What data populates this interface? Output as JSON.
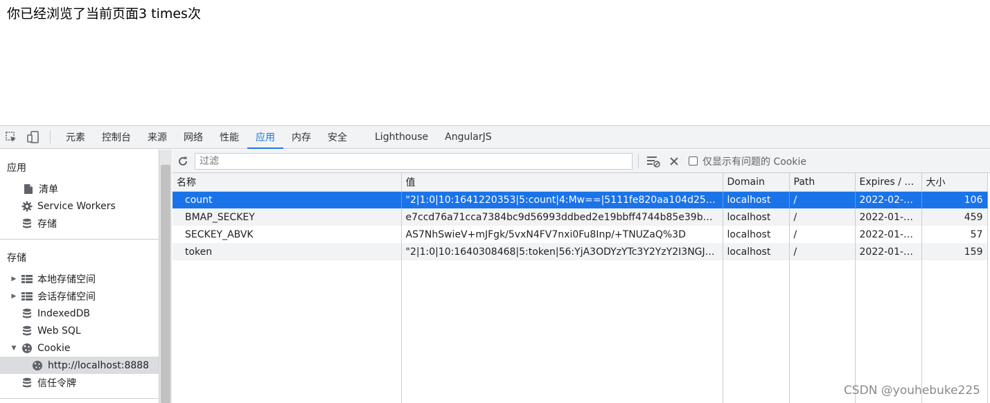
{
  "page": {
    "visit_text": "你已经浏览了当前页面3 times次"
  },
  "devtools": {
    "tabs": [
      "元素",
      "控制台",
      "来源",
      "网络",
      "性能",
      "应用",
      "内存",
      "安全",
      "Lighthouse",
      "AngularJS"
    ],
    "active_tab": "应用",
    "sidebar": {
      "section_app": "应用",
      "app_items": [
        "清单",
        "Service Workers",
        "存储"
      ],
      "section_storage": "存储",
      "storage_items": [
        "本地存储空间",
        "会话存储空间",
        "IndexedDB",
        "Web SQL",
        "Cookie"
      ],
      "cookie_origin": "http://localhost:8888",
      "trust_tokens": "信任令牌"
    },
    "toolbar": {
      "filter_placeholder": "过滤",
      "only_issues_label": "仅显示有问题的 Cookie"
    },
    "table": {
      "headers": [
        "名称",
        "值",
        "Domain",
        "Path",
        "Expires / M...",
        "大小"
      ],
      "rows": [
        [
          "count",
          "\"2|1:0|10:1641220353|5:count|4:Mw==|5111fe820aa104d25d0164c...",
          "localhost",
          "/",
          "2022-02-0...",
          "106"
        ],
        [
          "BMAP_SECKEY",
          "e7ccd76a71cca7384bc9d56993ddbed2e19bbff4744b85e39bb3d65...",
          "localhost",
          "/",
          "2022-01-3...",
          "459"
        ],
        [
          "SECKEY_ABVK",
          "AS7NhSwieV+mJFgk/5vxN4FV7nxi0Fu8Inp/+TNUZaQ%3D",
          "localhost",
          "/",
          "2022-01-3...",
          "57"
        ],
        [
          "token",
          "\"2|1:0|10:1640308468|5:token|56:YjA3ODYzYTc3Y2YzY2I3NGJmNzY...",
          "localhost",
          "/",
          "2022-01-2...",
          "159"
        ]
      ],
      "selected_row": 0
    }
  },
  "watermark": "CSDN @youhebuke225",
  "colors": {
    "accent": "#1a73e8",
    "panel_bg": "#f1f3f4"
  }
}
